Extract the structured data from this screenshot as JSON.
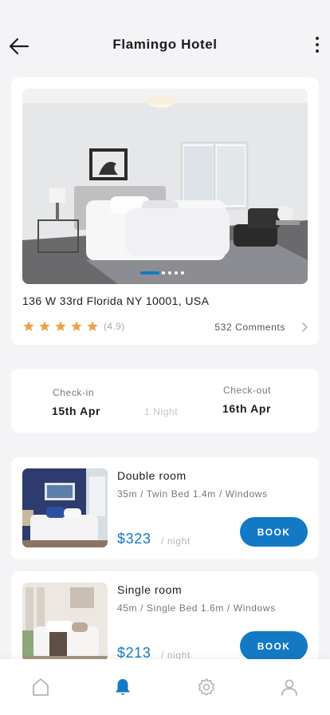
{
  "header": {
    "title": "Flamingo Hotel"
  },
  "hotel": {
    "address": "136 W 33rd Florida NY 10001, USA",
    "stars": 5,
    "rating": "(4.9)",
    "comments": "532 Comments",
    "photo_count": 5,
    "active_photo": 1
  },
  "stay": {
    "checkin_label": "Check-in",
    "checkin_value": "15th Apr",
    "nights": "1 Night",
    "checkout_label": "Check-out",
    "checkout_value": "16th Apr"
  },
  "rooms": [
    {
      "name": "Double room",
      "details": "35m / Twin Bed 1.4m / Windows",
      "price": "$323",
      "per": "/ night",
      "book_label": "BOOK"
    },
    {
      "name": "Single room",
      "details": "45m / Single Bed 1.6m / Windows",
      "price": "$213",
      "per": "/ night",
      "book_label": "BOOK"
    }
  ],
  "tabbar": {
    "items": [
      "home-icon",
      "bell-icon",
      "gear-icon",
      "profile-icon"
    ],
    "active": "bell-icon"
  },
  "colors": {
    "accent": "#1379c4",
    "star": "#f0a04b",
    "background": "#f4f4f6"
  }
}
